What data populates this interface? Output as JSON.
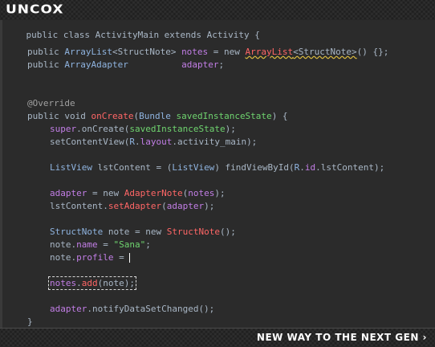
{
  "brand": {
    "logo": "UNCOX",
    "tagline": "NEW WAY TO THE NEXT GEN ›"
  },
  "colors": {
    "background": "#2b2b2b",
    "bar": "#1f1f1f",
    "keyword": "#a9b7c6",
    "class": "#8fb4e0",
    "field": "#c27ee6",
    "string": "#6fd46f",
    "new_class": "#ff6666"
  },
  "code": {
    "l0": {
      "a": "public class ActivityMain extends Activity {"
    },
    "l1": {
      "a": "public ",
      "b": "ArrayList",
      "c": "<StructNote> ",
      "d": "notes",
      "e": " = new ",
      "f": "ArrayList",
      "g": "<StructNote>",
      "h": "() {};"
    },
    "l2": {
      "a": "public ",
      "b": "ArrayAdapter",
      "c": "          ",
      "d": "adapter",
      ";": ";"
    },
    "l3": {
      "a": "@Override"
    },
    "l4": {
      "a": "public void ",
      "b": "onCreate",
      "c": "(",
      "d": "Bundle",
      "e": " ",
      "f": "savedInstanceState",
      "g": ") {"
    },
    "l5": {
      "a": "super",
      ".": ".",
      "b": "onCreate",
      "c": "(",
      "d": "savedInstanceState",
      "e": ");"
    },
    "l6": {
      "a": "setContentView(",
      "b": "R",
      ".": ".",
      "c": "layout",
      ".2": ".",
      "d": "activity_main",
      "e": ");"
    },
    "l7": {
      "a": "ListView",
      "b": " lstContent = (",
      "c": "ListView",
      "d": ") findViewById(",
      "e": "R",
      ".": ".",
      "f": "id",
      ".2": ".",
      "g": "lstContent);"
    },
    "l8": {
      "a": "adapter",
      "b": " = new ",
      "c": "AdapterNote",
      "d": "(",
      "e": "notes",
      "f": ");"
    },
    "l9": {
      "a": "lstContent.",
      "b": "setAdapter",
      "c": "(",
      "d": "adapter",
      "e": ");"
    },
    "l10": {
      "a": "StructNote",
      "b": " note = new ",
      "c": "StructNote",
      "d": "();"
    },
    "l11": {
      "a": "note.",
      "b": "name",
      "c": " = ",
      "d": "\"Sana\"",
      "e": ";"
    },
    "l12": {
      "a": "note.",
      "b": "profile",
      "c": " = "
    },
    "l13": {
      "a": "notes",
      ".": ".",
      "b": "add",
      "c": "(note);"
    },
    "l14": {
      "a": "adapter",
      ".": ".",
      "b": "notifyDataSetChanged",
      "c": "();"
    },
    "l15": {
      "a": "}"
    }
  }
}
